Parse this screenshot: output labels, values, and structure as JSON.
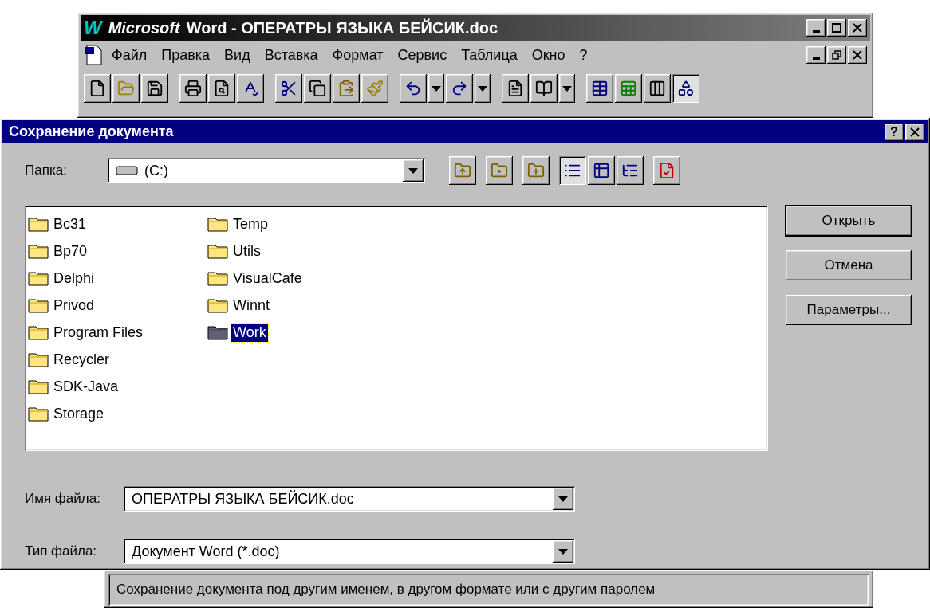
{
  "word_window": {
    "logo": "W",
    "brand": "Microsoft",
    "title": "Word - ОПЕРАТРЫ ЯЗЫКА БЕЙСИК.doc",
    "menu": [
      "Файл",
      "Правка",
      "Вид",
      "Вставка",
      "Формат",
      "Сервис",
      "Таблица",
      "Окно",
      "?"
    ],
    "drawing_button": {
      "pressed": true
    }
  },
  "dialog": {
    "title": "Сохранение документа",
    "help": "?",
    "folder_label": "Папка:",
    "folder_value": "(C:)",
    "view_buttons": [
      {
        "selected": true
      },
      {
        "selected": false
      },
      {
        "selected": false
      }
    ],
    "files": [
      {
        "name": "Bc31",
        "selected": false
      },
      {
        "name": "Bp70",
        "selected": false
      },
      {
        "name": "Delphi",
        "selected": false
      },
      {
        "name": "Privod",
        "selected": false
      },
      {
        "name": "Program Files",
        "selected": false
      },
      {
        "name": "Recycler",
        "selected": false
      },
      {
        "name": "SDK-Java",
        "selected": false
      },
      {
        "name": "Storage",
        "selected": false
      },
      {
        "name": "Temp",
        "selected": false
      },
      {
        "name": "Utils",
        "selected": false
      },
      {
        "name": "VisualCafe",
        "selected": false
      },
      {
        "name": "Winnt",
        "selected": false
      },
      {
        "name": "Work",
        "selected": true
      }
    ],
    "buttons": [
      {
        "label": "Открыть",
        "default": true
      },
      {
        "label": "Отмена",
        "default": false
      },
      {
        "label": "Параметры...",
        "default": false
      }
    ],
    "filename_label": "Имя файла:",
    "filename": "ОПЕРАТРЫ ЯЗЫКА БЕЙСИК.doc",
    "filetype_label": "Тип файла:",
    "filetype": "Документ Word (*.doc)"
  },
  "status_bar": "Сохранение документа под другим именем, в другом формате или с другим паролем"
}
